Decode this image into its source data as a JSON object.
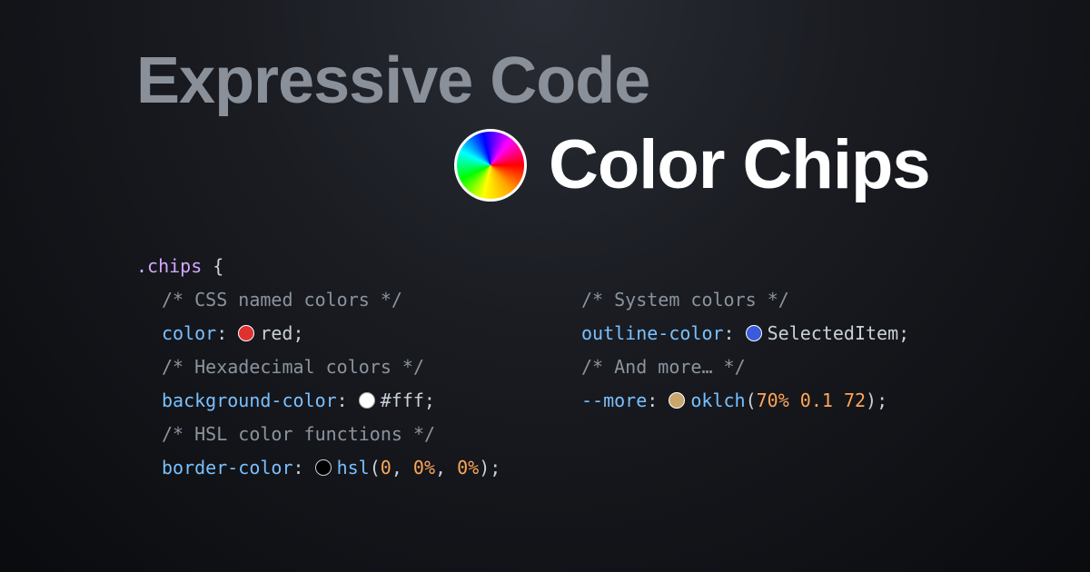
{
  "hero": {
    "line1": "Expressive Code",
    "line2": "Color Chips"
  },
  "code": {
    "selector": ".chips",
    "open_brace": "{",
    "left": {
      "comment1": "/* CSS named colors */",
      "prop1": "color",
      "val1": "red",
      "comment2": "/* Hexadecimal colors */",
      "prop2": "background-color",
      "val2": "#fff",
      "comment3": "/* HSL color functions */",
      "prop3": "border-color",
      "fn3": "hsl",
      "arg3a": "0",
      "arg3b": "0%",
      "arg3c": "0%"
    },
    "right": {
      "comment1": "/* System colors */",
      "prop1": "outline-color",
      "val1": "SelectedItem",
      "comment2": "/* And more… */",
      "prop2": "--more",
      "fn2": "oklch",
      "arg2a": "70%",
      "arg2b": "0.1",
      "arg2c": "72"
    }
  }
}
